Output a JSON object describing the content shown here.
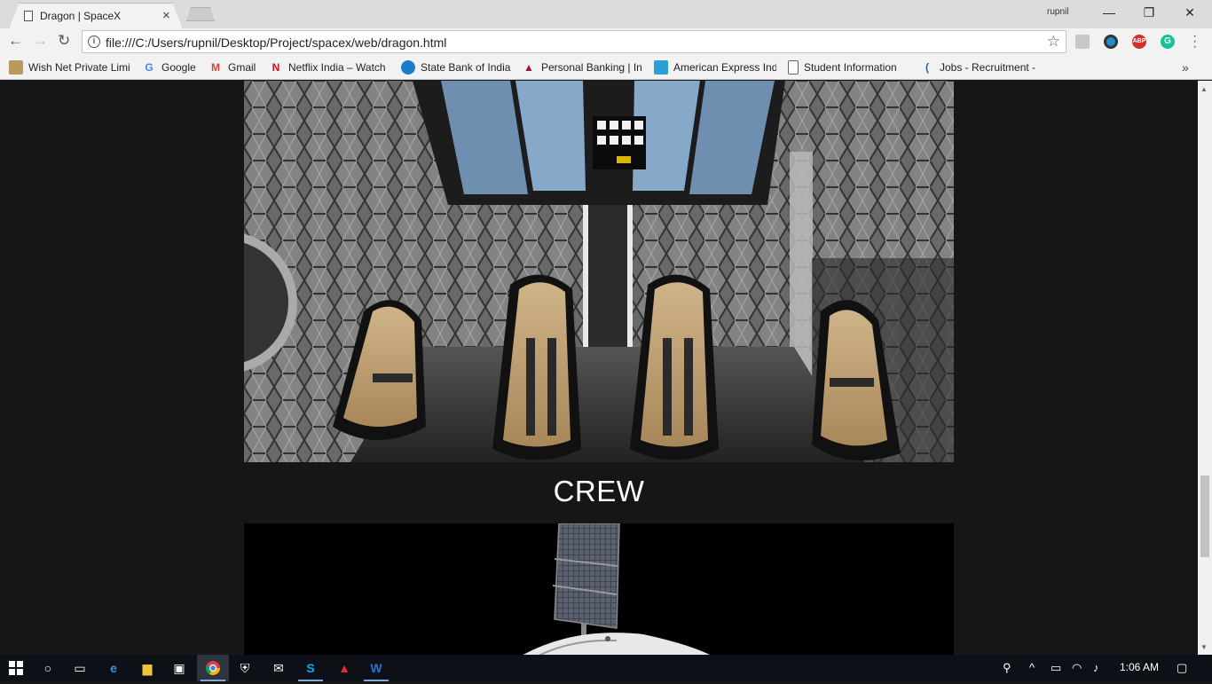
{
  "browser": {
    "tab_title": "Dragon | SpaceX",
    "tab_close": "×",
    "profile": "rupnil",
    "window_controls": {
      "minimize": "—",
      "restore": "❐",
      "close": "✕"
    },
    "url": "file:///C:/Users/rupnil/Desktop/Project/spacex/web/dragon.html",
    "bookmarks": [
      {
        "label": "Wish Net Private Limi",
        "icon": "wishnet-icon"
      },
      {
        "label": "Google",
        "icon": "google-icon"
      },
      {
        "label": "Gmail",
        "icon": "gmail-icon"
      },
      {
        "label": "Netflix India – Watch",
        "icon": "netflix-icon"
      },
      {
        "label": "State Bank of India",
        "icon": "sbi-icon"
      },
      {
        "label": "Personal Banking | Int",
        "icon": "axis-bank-icon"
      },
      {
        "label": "American Express Ind",
        "icon": "amex-icon"
      },
      {
        "label": "Student Information",
        "icon": "page-icon"
      },
      {
        "label": "Jobs - Recruitment -",
        "icon": "jobs-icon"
      }
    ],
    "more_bookmarks": "»"
  },
  "page": {
    "crew_heading": "CREW"
  },
  "taskbar": {
    "clock": "1:06 AM"
  },
  "colors": {
    "page_background": "#161616",
    "heading_text": "#ffffff",
    "taskbar": "#0d1117"
  }
}
